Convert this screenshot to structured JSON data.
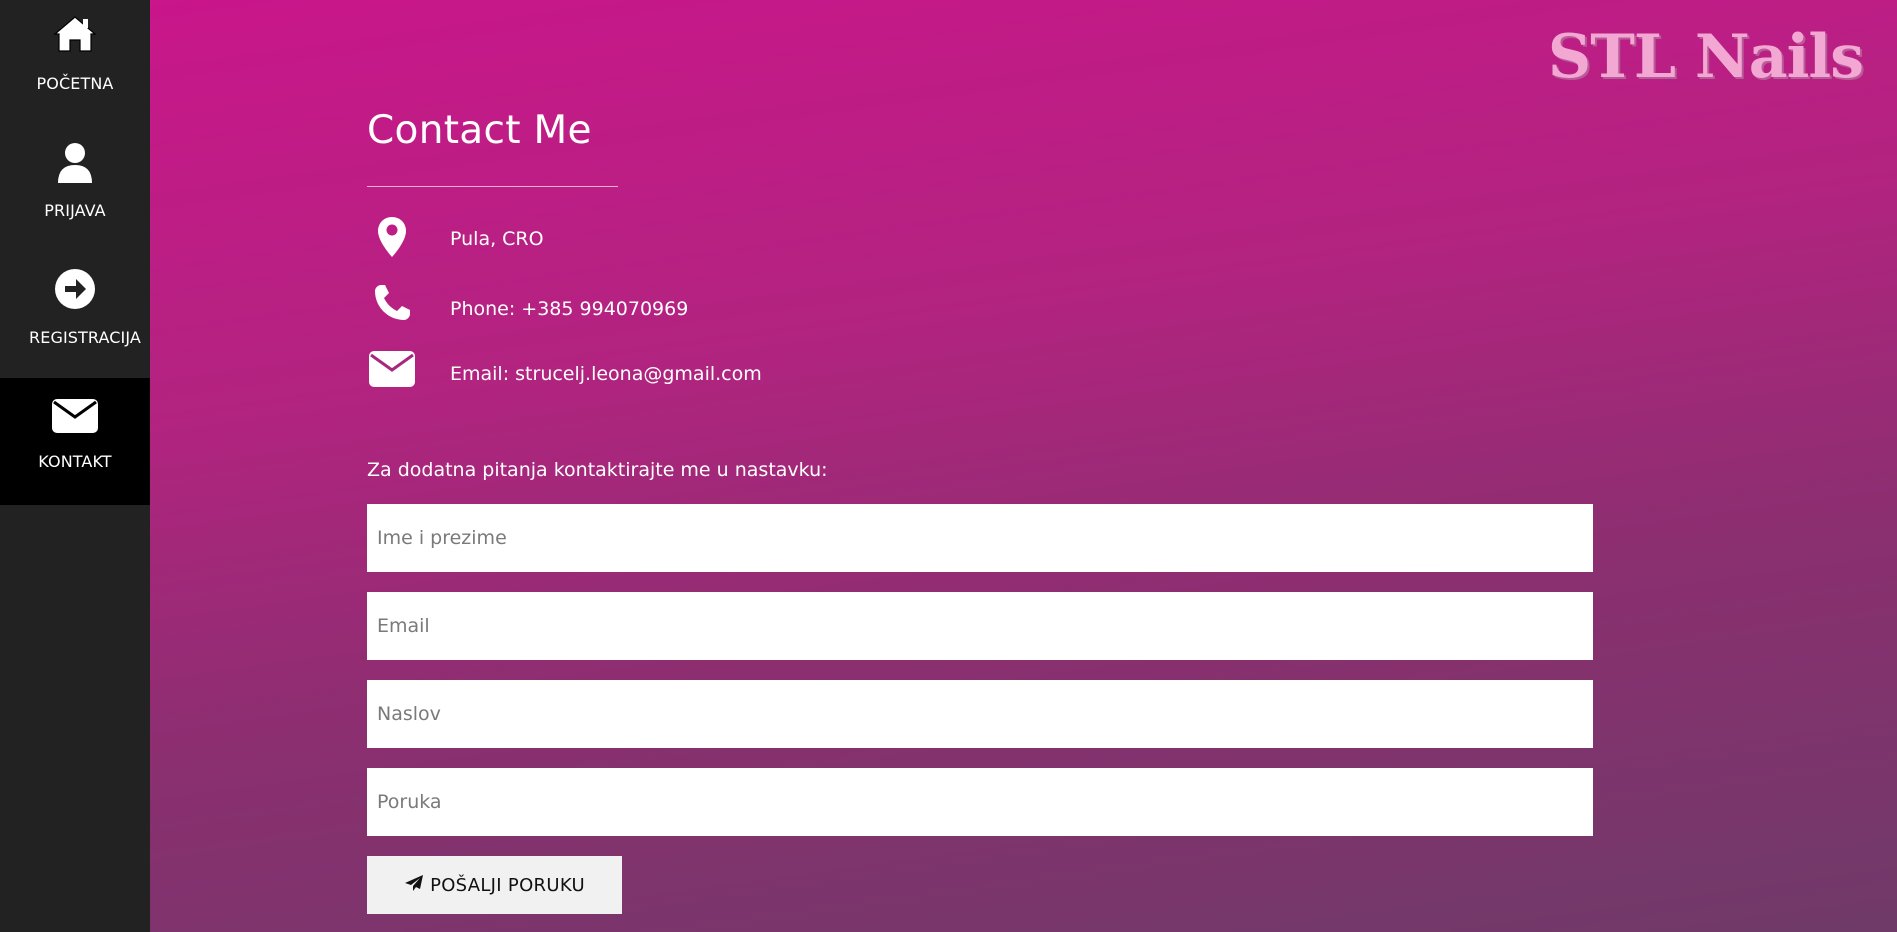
{
  "sidebar": {
    "items": [
      {
        "label": "POČETNA",
        "icon": "home-icon",
        "active": false
      },
      {
        "label": "PRIJAVA",
        "icon": "user-icon",
        "active": false
      },
      {
        "label": "REGISTRACIJA",
        "icon": "arrow-right-circle-icon",
        "active": false
      },
      {
        "label": "KONTAKT",
        "icon": "envelope-icon",
        "active": true
      }
    ]
  },
  "brand": {
    "logo_text": "STL Nails",
    "logo_color": "#f3a7d3"
  },
  "contact": {
    "title": "Contact Me",
    "location": "Pula, CRO",
    "phone": "Phone: +385 994070969",
    "email": "Email: strucelj.leona@gmail.com"
  },
  "form": {
    "intro": "Za dodatna pitanja kontaktirajte me u nastavku:",
    "name_placeholder": "Ime i prezime",
    "email_placeholder": "Email",
    "subject_placeholder": "Naslov",
    "message_placeholder": "Poruka",
    "submit_label": "POŠALJI PORUKU"
  },
  "colors": {
    "sidebar_bg": "#222222",
    "sidebar_active_bg": "#000000",
    "gradient_top": "#c9168a",
    "gradient_bottom": "#6f3a68"
  }
}
